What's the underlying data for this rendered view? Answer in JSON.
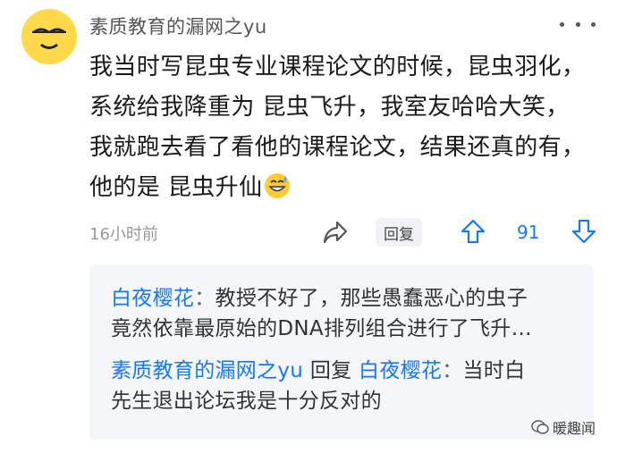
{
  "comment": {
    "username": "素质教育的漏网之yu",
    "lines": [
      "我当时写昆虫专业课程论文的时候，昆虫羽化，",
      "系统给我降重为 昆虫飞升，我室友哈哈大笑，",
      "我就跑去看了看他的课程论文，结果还真的有，",
      "他的是 昆虫升仙"
    ],
    "emoji": "sweat-smile-emoji",
    "time": "16小时前",
    "reply_label": "回复",
    "vote_count": "91"
  },
  "replies": [
    {
      "author": "白夜樱花",
      "separator": "：",
      "lines": [
        "教授不好了，那些愚蠢恶心的虫子",
        "竟然依靠最原始的DNA排列组合进行了飞升…"
      ]
    },
    {
      "author": "素质教育的漏网之yu",
      "reply_word": " 回复 ",
      "target": "白夜樱花",
      "separator": "：",
      "text_first": "当时白",
      "text_second": "先生退出论坛我是十分反对的"
    }
  ],
  "watermark": "暖趣闻",
  "colors": {
    "link": "#1677ff",
    "avatar": "#ffd94a",
    "panel": "#f5f6f9"
  }
}
